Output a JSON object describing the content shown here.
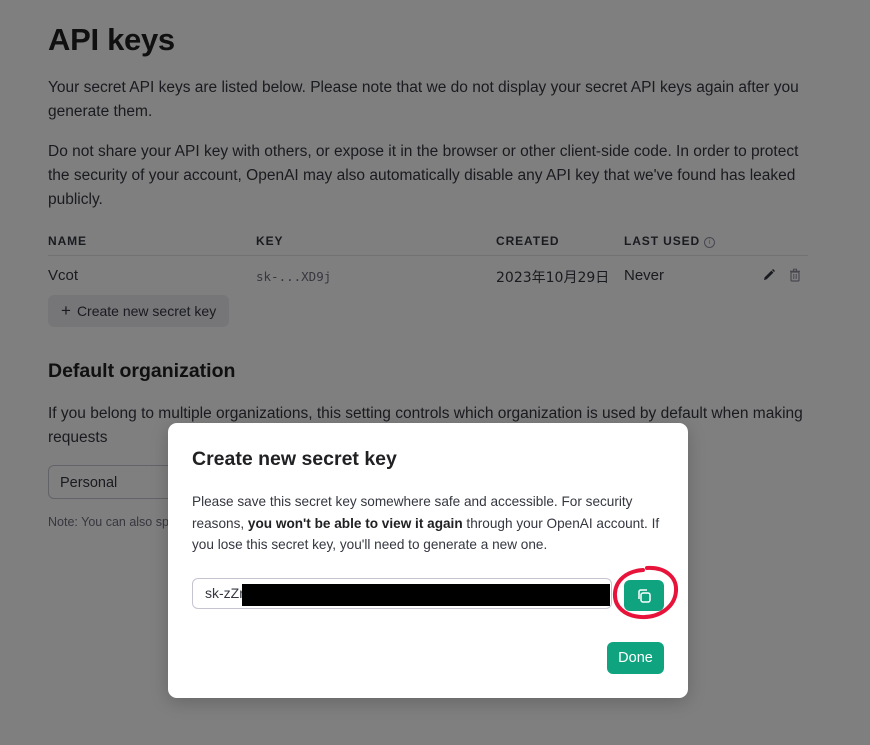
{
  "page": {
    "title": "API keys",
    "intro_1": "Your secret API keys are listed below. Please note that we do not display your secret API keys again after you generate them.",
    "intro_2": "Do not share your API key with others, or expose it in the browser or other client-side code. In order to protect the security of your account, OpenAI may also automatically disable any API key that we've found has leaked publicly."
  },
  "table": {
    "headers": {
      "name": "NAME",
      "key": "KEY",
      "created": "CREATED",
      "last_used": "LAST USED"
    },
    "rows": [
      {
        "name": "Vcot",
        "key": "sk-...XD9j",
        "created": "2023年10月29日",
        "last_used": "Never"
      }
    ],
    "row_icons": [
      "pencil-icon",
      "trash-icon"
    ]
  },
  "create_button": {
    "icon": "plus-icon",
    "label": "Create new secret key"
  },
  "default_org": {
    "title": "Default organization",
    "description": "If you belong to multiple organizations, this setting controls which organization is used by default when making requests",
    "selected": "Personal",
    "note": "Note: You can also sp"
  },
  "modal": {
    "title": "Create new secret key",
    "body_part1": "Please save this secret key somewhere safe and accessible. For security reasons, ",
    "body_bold": "you won't be able to view it again",
    "body_part2": " through your OpenAI account. If you lose this secret key, you'll need to generate a new one.",
    "key_value": "sk-zZr",
    "copy_icon": "copy-icon",
    "done_label": "Done"
  },
  "colors": {
    "accent": "#10a37f",
    "overlay": "rgba(0,0,0,0.5)",
    "annotation": "#e8133a"
  }
}
